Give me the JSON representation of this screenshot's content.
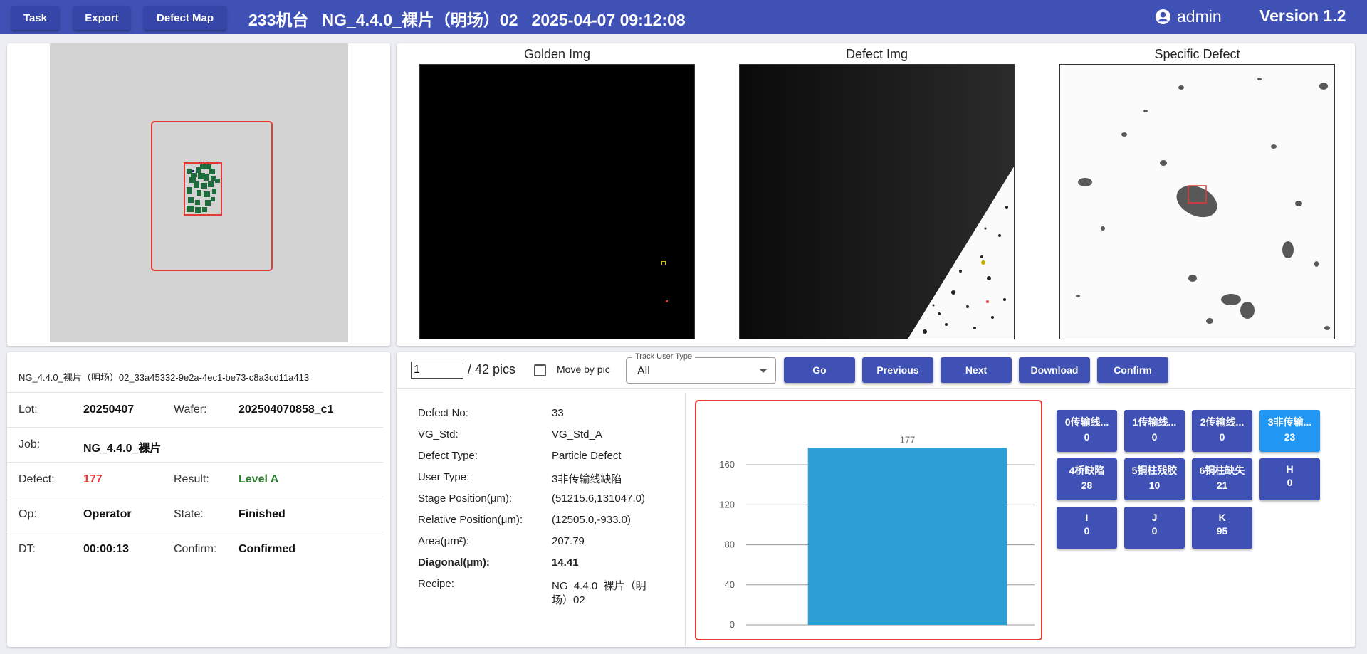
{
  "nav": {
    "task": "Task",
    "export": "Export",
    "defect_map": "Defect Map"
  },
  "header": {
    "title": "233机台   NG_4.4.0_裸片（明场）02   2025-04-07 09:12:08",
    "user": "admin",
    "version": "Version 1.2"
  },
  "images": {
    "golden": "Golden Img",
    "defect": "Defect Img",
    "specific": "Specific Defect"
  },
  "info": {
    "id": "NG_4.4.0_裸片（明场）02_33a45332-9e2a-4ec1-be73-c8a3cd11a413",
    "lot_label": "Lot:",
    "lot": "20250407",
    "wafer_label": "Wafer:",
    "wafer": "202504070858_c1",
    "job_label": "Job:",
    "job": "NG_4.4.0_裸片",
    "defect_label": "Defect:",
    "defect": "177",
    "result_label": "Result:",
    "result": "Level A",
    "op_label": "Op:",
    "op": "Operator",
    "state_label": "State:",
    "state": "Finished",
    "dt_label": "DT:",
    "dt": "00:00:13",
    "confirm_label": "Confirm:",
    "confirm": "Confirmed"
  },
  "controls": {
    "page": "1",
    "total": "/ 42 pics",
    "move_by_pic": "Move by pic",
    "track_label": "Track User Type",
    "track_value": "All",
    "go": "Go",
    "previous": "Previous",
    "next": "Next",
    "download": "Download",
    "confirm": "Confirm"
  },
  "details": [
    {
      "label": "Defect No:",
      "value": "33",
      "bold": false
    },
    {
      "label": "VG_Std:",
      "value": "VG_Std_A",
      "bold": false
    },
    {
      "label": "Defect Type:",
      "value": "Particle Defect",
      "bold": false
    },
    {
      "label": "User Type:",
      "value": "3非传输线缺陷",
      "bold": false
    },
    {
      "label": "Stage Position(μm):",
      "value": "(51215.6,131047.0)",
      "bold": false
    },
    {
      "label": "Relative Position(μm):",
      "value": "(12505.0,-933.0)",
      "bold": false
    },
    {
      "label": "Area(μm²):",
      "value": "207.79",
      "bold": false
    },
    {
      "label": "Diagonal(μm):",
      "value": "14.41",
      "bold": true
    },
    {
      "label": "Recipe:",
      "value": "NG_4.4.0_裸片（明",
      "value2": "场）02",
      "bold": false
    }
  ],
  "chart_data": {
    "type": "bar",
    "categories": [
      ""
    ],
    "values": [
      177
    ],
    "data_labels": [
      "177"
    ],
    "ylim": [
      0,
      195
    ],
    "yticks": [
      0,
      40,
      80,
      120,
      160
    ],
    "grid": true,
    "bar_color": "#2b9fd6"
  },
  "user_types": [
    {
      "name": "0传输线...",
      "count": "0",
      "selected": false
    },
    {
      "name": "1传输线...",
      "count": "0",
      "selected": false
    },
    {
      "name": "2传输线...",
      "count": "0",
      "selected": false
    },
    {
      "name": "3非传输...",
      "count": "23",
      "selected": true
    },
    {
      "name": "4桥缺陷",
      "count": "28",
      "selected": false
    },
    {
      "name": "5铜柱残胶",
      "count": "10",
      "selected": false
    },
    {
      "name": "6铜柱缺失",
      "count": "21",
      "selected": false
    },
    {
      "name": "H",
      "count": "0",
      "selected": false
    },
    {
      "name": "I",
      "count": "0",
      "selected": false
    },
    {
      "name": "J",
      "count": "0",
      "selected": false
    },
    {
      "name": "K",
      "count": "95",
      "selected": false
    }
  ],
  "colors": {
    "header": "#3f51b5",
    "selected": "#2196f3",
    "alert": "#e53935",
    "ok": "#2e7d32"
  }
}
